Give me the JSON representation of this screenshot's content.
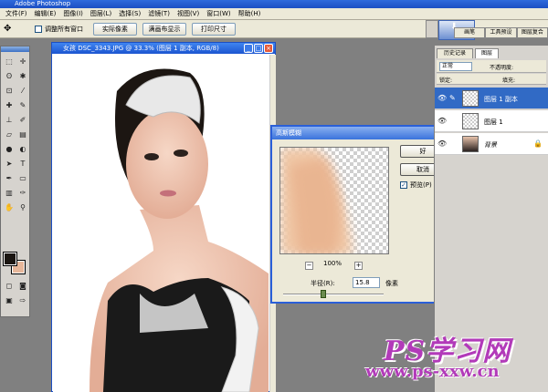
{
  "app": {
    "title": "Adobe Photoshop"
  },
  "menu": [
    "文件(F)",
    "编辑(E)",
    "图像(I)",
    "图层(L)",
    "选择(S)",
    "滤镜(T)",
    "视图(V)",
    "窗口(W)",
    "帮助(H)"
  ],
  "options": {
    "resize_all": "调整所有窗口",
    "actual_pixels": "实际像素",
    "fit_screen": "满画布显示",
    "print_size": "打印尺寸"
  },
  "panel_tabs": [
    "画笔",
    "工具预设",
    "图层复合"
  ],
  "document": {
    "title": "女孩 DSC_3343.JPG @ 33.3% (图层 1 副本, RGB/8)"
  },
  "dialog": {
    "title": "高斯模糊",
    "ok": "好",
    "cancel": "取消",
    "preview_label": "预览(P)",
    "zoom": "100%",
    "zoom_minus": "−",
    "zoom_plus": "+",
    "radius_label": "半径(R):",
    "radius_value": "15.8",
    "radius_unit": "像素",
    "slider_level": 0.4
  },
  "layers_panel": {
    "tabs": [
      "历史记录",
      "图层"
    ],
    "blend_mode": "正常",
    "opacity_label": "不透明度:",
    "lock_label": "锁定:",
    "fill_label": "填充:",
    "layers": [
      {
        "name": "图层 1 副本",
        "selected": true
      },
      {
        "name": "图层 1",
        "selected": false
      },
      {
        "name": "背景",
        "selected": false
      }
    ]
  },
  "watermark": {
    "logo": "PS学习网",
    "url": "www.ps-xxw.cn"
  },
  "colors": {
    "foreground": "#1a1511",
    "background": "#e7b79a",
    "accent": "#b23ab9",
    "selection": "#316ac5"
  }
}
